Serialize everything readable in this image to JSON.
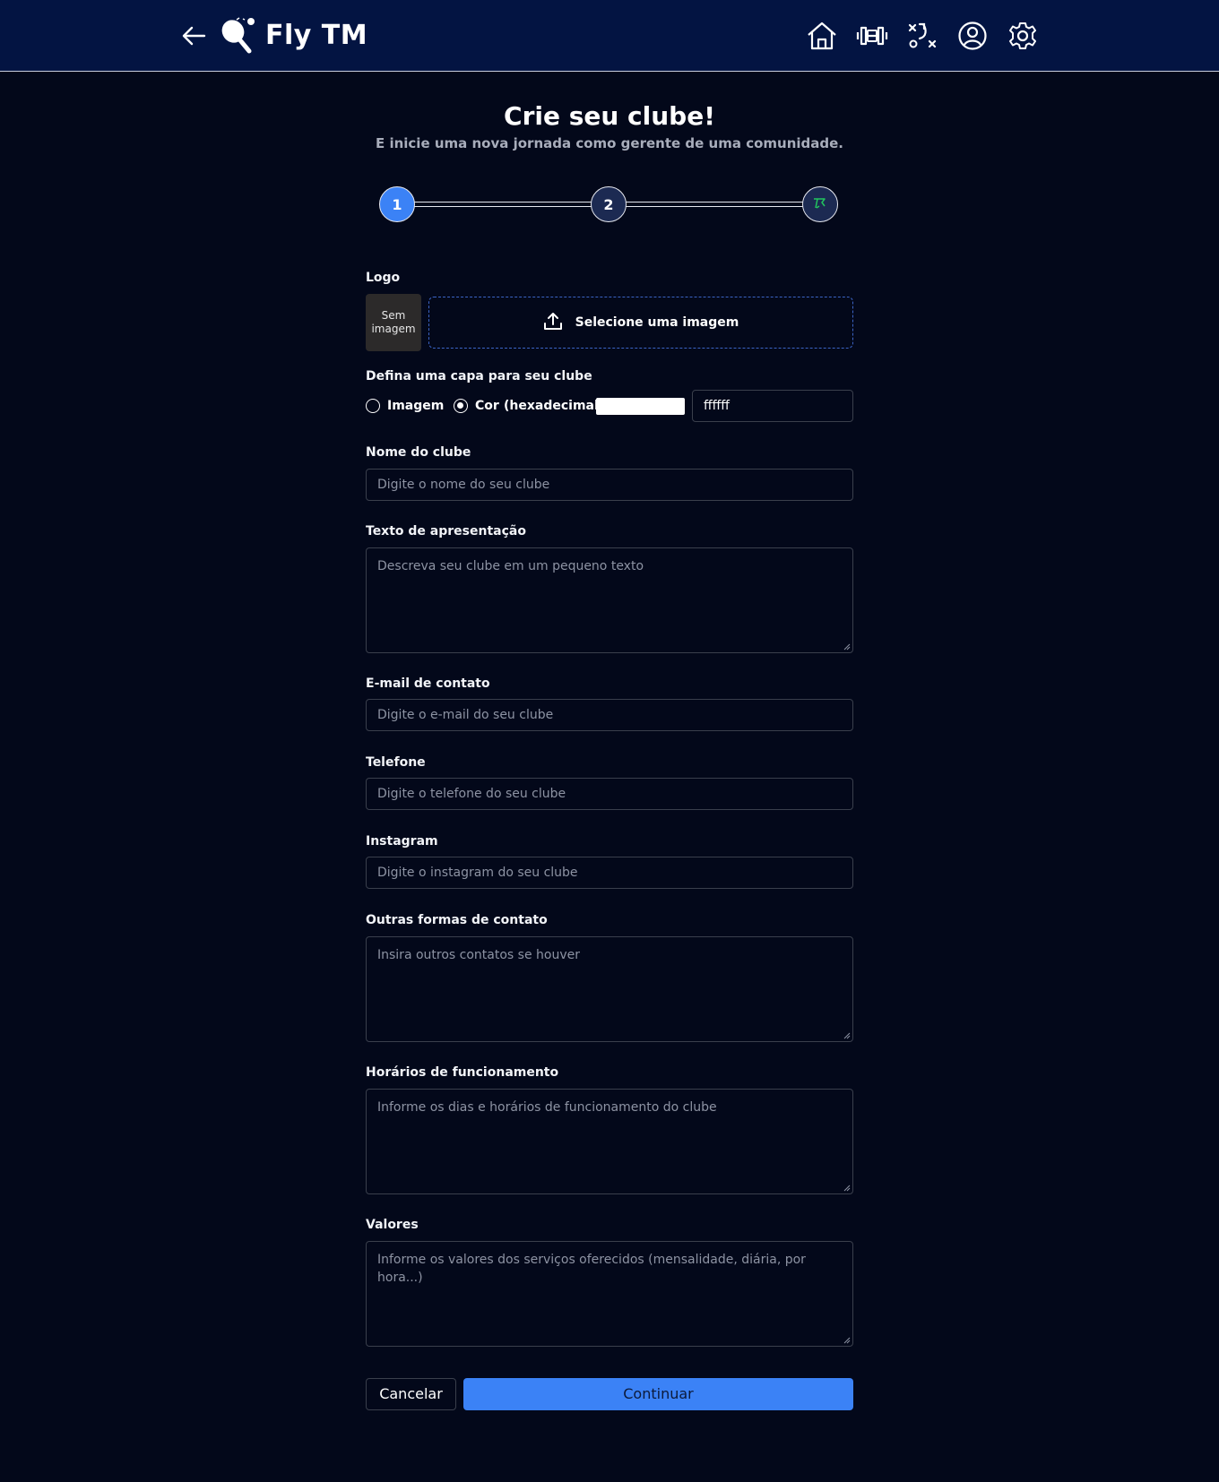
{
  "header": {
    "title": "Fly TM",
    "icons": [
      "back-arrow-icon",
      "ping-pong-logo-icon",
      "home-icon",
      "dumbbell-icon",
      "tactics-icon",
      "user-circle-icon",
      "gear-icon"
    ]
  },
  "page": {
    "title": "Crie seu clube!",
    "subtitle": "E inicie uma nova jornada como gerente de uma comunidade."
  },
  "stepper": {
    "steps": [
      {
        "label": "1",
        "state": "active",
        "color": "#3b82f6"
      },
      {
        "label": "2",
        "state": "pending",
        "color": "#1c2a52"
      },
      {
        "label": "",
        "state": "pending",
        "icon": "finish-flag-icon",
        "color": "#1c2a52",
        "icon_color": "#22c55e"
      }
    ]
  },
  "form": {
    "logo_label": "Logo",
    "no_image_text": "Sem imagem",
    "upload_text": "Selecione uma imagem",
    "cover_label": "Defina uma capa para seu clube",
    "cover_option_image": "Imagem",
    "cover_option_color": "Cor",
    "cover_color_hint": "(hexadecimal):",
    "cover_color_value": "ffffff",
    "cover_color_swatch": "#ffffff",
    "selected_cover_option": "Cor",
    "name_label": "Nome do clube",
    "name_placeholder": "Digite o nome do seu clube",
    "intro_label": "Texto de apresentação",
    "intro_placeholder": "Descreva seu clube em um pequeno texto",
    "email_label": "E-mail de contato",
    "email_placeholder": "Digite o e-mail do seu clube",
    "phone_label": "Telefone",
    "phone_placeholder": "Digite o telefone do seu clube",
    "instagram_label": "Instagram",
    "instagram_placeholder": "Digite o instagram do seu clube",
    "other_label": "Outras formas de contato",
    "other_placeholder": "Insira outros contatos se houver",
    "hours_label": "Horários de funcionamento",
    "hours_placeholder": "Informe os dias e horários de funcionamento do clube",
    "prices_label": "Valores",
    "prices_placeholder": "Informe os valores dos serviços oferecidos (mensalidade, diária, por hora...)"
  },
  "actions": {
    "cancel": "Cancelar",
    "continue": "Continuar"
  },
  "colors": {
    "header_bg": "#031442",
    "page_bg": "#03081a",
    "primary": "#3b82f6"
  }
}
